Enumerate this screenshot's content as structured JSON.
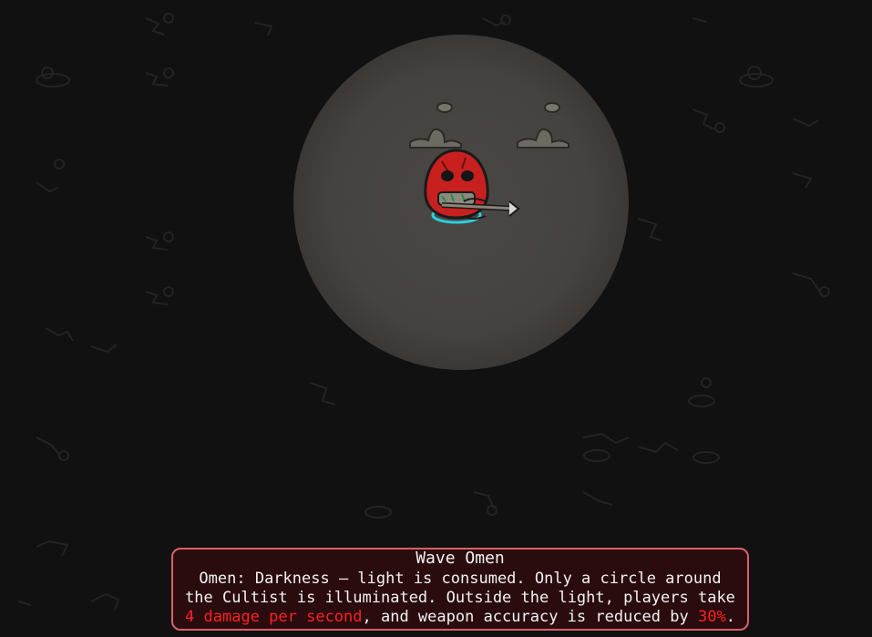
{
  "omen": {
    "title": "Wave Omen",
    "text_before_damage": "Omen: Darkness — light is consumed. Only a circle around the Cultist is illuminated. Outside the light, players take ",
    "damage": "4 damage per second",
    "text_middle": ", and weapon accuracy is reduced by ",
    "accuracy": "30%",
    "text_end": "."
  },
  "colors": {
    "background": "#111111",
    "light_circle": "#4a4744",
    "panel_bg": "#2a0c0f",
    "panel_border": "#d9606a",
    "highlight": "#ff2020",
    "player_red": "#c8201f"
  }
}
